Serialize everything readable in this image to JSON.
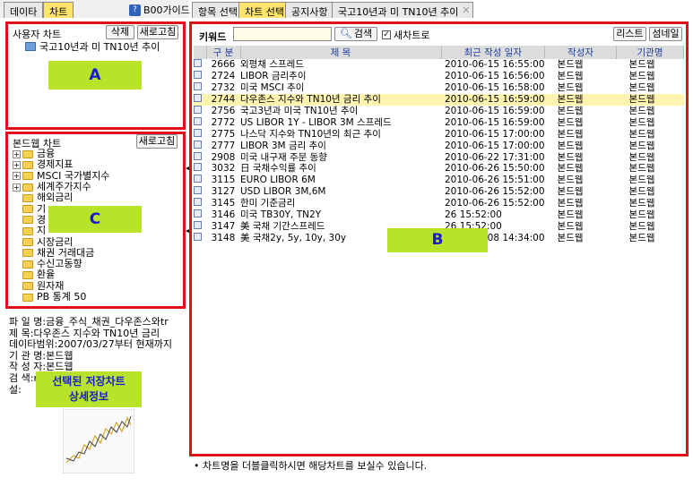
{
  "left_tabs": [
    "데이타",
    "차트"
  ],
  "guide": {
    "icon": "?",
    "label": "B00가이드"
  },
  "right_tabs": [
    "항목 선택",
    "차트 선택",
    "공지사항",
    "국고10년과 미 TN10년 추이"
  ],
  "user_chart": {
    "title": "사용자 차트",
    "delete": "삭제",
    "refresh": "새로고침",
    "item": "국고10년과 미 TN10년 추이"
  },
  "bond_chart": {
    "title": "본드웹 차트",
    "refresh": "새로고침",
    "items": [
      {
        "label": "금융",
        "expandable": true
      },
      {
        "label": "경제지표",
        "expandable": true
      },
      {
        "label": "MSCI 국가별지수",
        "expandable": true
      },
      {
        "label": "세계주가지수",
        "expandable": true
      },
      {
        "label": "해외금리",
        "expandable": false
      },
      {
        "label": "기",
        "expandable": false
      },
      {
        "label": "경",
        "expandable": false
      },
      {
        "label": "지",
        "expandable": false
      },
      {
        "label": "시장금리",
        "expandable": false
      },
      {
        "label": "채권 거래대금",
        "expandable": false
      },
      {
        "label": "수신고동향",
        "expandable": false
      },
      {
        "label": "환율",
        "expandable": false
      },
      {
        "label": "원자재",
        "expandable": false
      },
      {
        "label": "PB 통계 50",
        "expandable": false
      }
    ]
  },
  "info": [
    {
      "key": "파 일 명",
      "value": "금융_주식_채권_다우존스와tr"
    },
    {
      "key": "제    목",
      "value": "다우존스 지수와 TN10년 금리"
    },
    {
      "key": "데이타범위",
      "value": "2007/03/27부터 현재까지"
    },
    {
      "key": "기 관 명",
      "value": "본드웹"
    },
    {
      "key": "작 성 자",
      "value": "본드웹"
    },
    {
      "key": "검 색",
      "value": "n"
    },
    {
      "key": "설",
      "value": ""
    }
  ],
  "labels": {
    "A": "A",
    "B": "B",
    "C": "C",
    "detail_line1": "선택된 저장차트",
    "detail_line2": "상세정보"
  },
  "search": {
    "keyword_label": "키워드",
    "value": "",
    "search_btn": "검색",
    "new_window": "새차트로",
    "list_btn": "리스트",
    "thumb_btn": "섬네일"
  },
  "table": {
    "columns": [
      "구 분",
      "제 목",
      "최근 작성 일자",
      "작성자",
      "기관명"
    ],
    "rows": [
      [
        "2666",
        "외평채 스프레드",
        "2010-06-15 16:55:00",
        "본드웹",
        "본드웹"
      ],
      [
        "2724",
        "LIBOR 금리추이",
        "2010-06-15 16:56:00",
        "본드웹",
        "본드웹"
      ],
      [
        "2732",
        "미국 MSCI 추이",
        "2010-06-15 16:58:00",
        "본드웹",
        "본드웹"
      ],
      [
        "2744",
        "다우존스 지수와 TN10년 금리 추이",
        "2010-06-15 16:59:00",
        "본드웹",
        "본드웹"
      ],
      [
        "2756",
        "국고3년과 미국 TN10년 추이",
        "2010-06-15 16:59:00",
        "본드웹",
        "본드웹"
      ],
      [
        "2772",
        "US LIBOR 1Y - LIBOR 3M 스프레드",
        "2010-06-15 16:59:00",
        "본드웹",
        "본드웹"
      ],
      [
        "2775",
        "나스닥 지수와 TN10년의 최근 추이",
        "2010-06-15 17:00:00",
        "본드웹",
        "본드웹"
      ],
      [
        "2777",
        "LIBOR 3M 금리 추이",
        "2010-06-15 17:00:00",
        "본드웹",
        "본드웹"
      ],
      [
        "2908",
        "미국 내구재 주문 동향",
        "2010-06-22 17:31:00",
        "본드웹",
        "본드웹"
      ],
      [
        "3032",
        "日 국채수익률 추이",
        "2010-06-26 15:50:00",
        "본드웹",
        "본드웹"
      ],
      [
        "3115",
        "EURO LIBOR 6M",
        "2010-06-26 15:51:00",
        "본드웹",
        "본드웹"
      ],
      [
        "3127",
        "USD LIBOR 3M,6M",
        "2010-06-26 15:52:00",
        "본드웹",
        "본드웹"
      ],
      [
        "3145",
        "한미 기준금리",
        "2010-06-26 15:52:00",
        "본드웹",
        "본드웹"
      ],
      [
        "3146",
        "미국 TB30Y, TN2Y",
        "26 15:52:00",
        "본드웹",
        "본드웹"
      ],
      [
        "3147",
        "美 국채 기간스프레드",
        "26 15:52:00",
        "본드웹",
        "본드웹"
      ],
      [
        "3148",
        "美 국채2y, 5y, 10y, 30y",
        "2010-07-08 14:34:00",
        "본드웹",
        "본드웹"
      ]
    ],
    "selected_index": 3
  },
  "status": "• 차트명을 더블클릭하시면 해당차트를 보실수 있습니다."
}
